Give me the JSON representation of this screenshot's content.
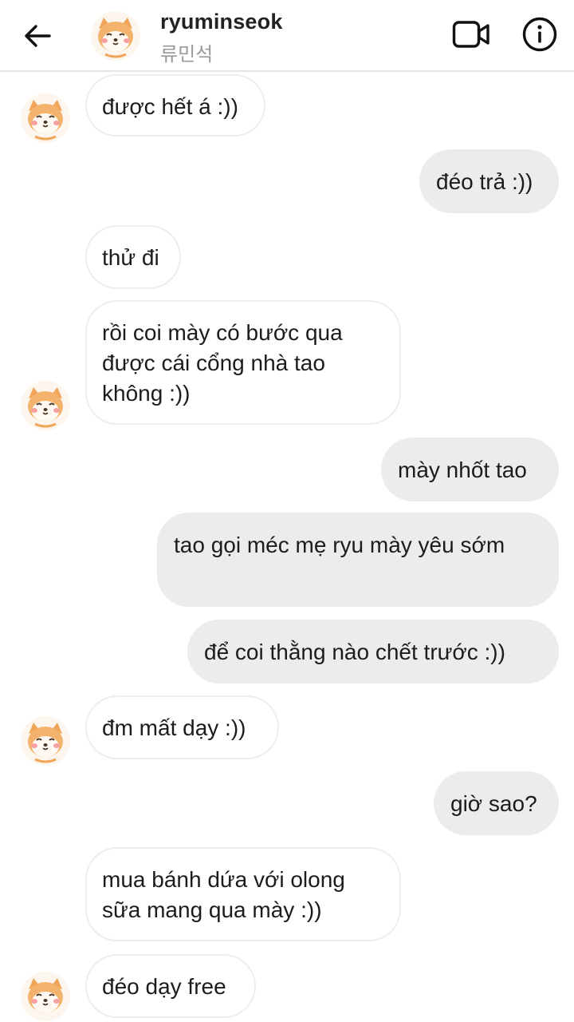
{
  "header": {
    "username": "ryuminseok",
    "subtitle": "류민석",
    "back_icon": "arrow-left-icon",
    "video_icon": "video-camera-icon",
    "info_icon": "info-circle-icon"
  },
  "messages": [
    {
      "dir": "in",
      "text": "được hết á :))",
      "avatar": true
    },
    {
      "dir": "out",
      "text": "đéo trả :))"
    },
    {
      "dir": "in",
      "text": "thử đi",
      "avatar": false
    },
    {
      "dir": "in",
      "text": "rồi coi mày có bước qua được cái cổng nhà tao không :))",
      "avatar": true
    },
    {
      "dir": "out",
      "text": "mày nhốt tao"
    },
    {
      "dir": "out",
      "text": "tao gọi méc mẹ ryu mày yêu sớm"
    },
    {
      "dir": "out",
      "text": "để coi thằng nào chết trước :))"
    },
    {
      "dir": "in",
      "text": "đm mất dạy :))",
      "avatar": true
    },
    {
      "dir": "out",
      "text": "giờ sao?"
    },
    {
      "dir": "in",
      "text": "mua bánh dứa với olong sữa mang qua mày :))",
      "avatar": false
    },
    {
      "dir": "in",
      "text": "đéo dạy free",
      "avatar": true
    }
  ],
  "colors": {
    "incoming_bg": "#ffffff",
    "incoming_border": "#ededed",
    "outgoing_bg": "#ececec",
    "text": "#1c1c1c",
    "subtitle": "#9a9a9a"
  }
}
